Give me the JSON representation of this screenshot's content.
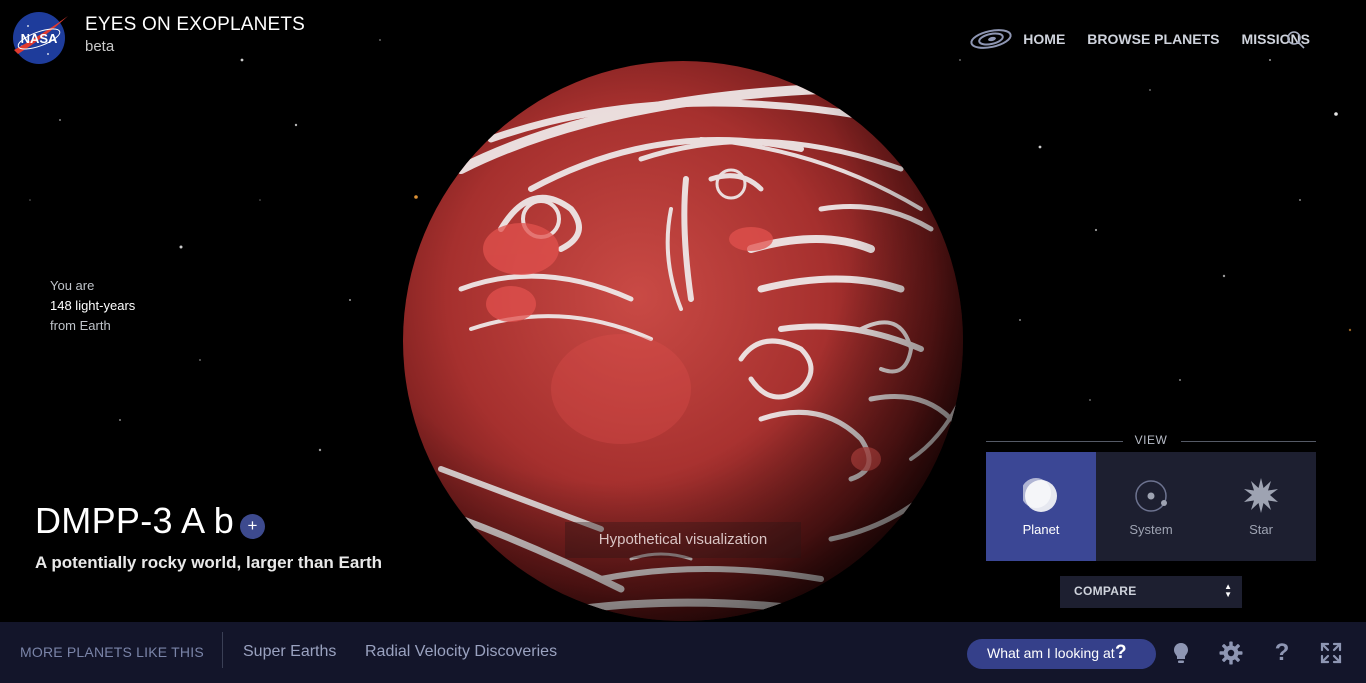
{
  "header": {
    "title": "EYES ON EXOPLANETS",
    "subtitle": "beta",
    "logo_text": "NASA",
    "nav": [
      {
        "label": "HOME"
      },
      {
        "label": "BROWSE PLANETS"
      },
      {
        "label": "MISSIONS"
      }
    ]
  },
  "distance": {
    "line1": "You are",
    "line2": "148 light-years",
    "line3": "from Earth"
  },
  "planet": {
    "name": "DMPP-3 A b",
    "plus_label": "+",
    "description": "A potentially rocky world, larger than Earth",
    "visualization_note": "Hypothetical visualization"
  },
  "view": {
    "heading": "VIEW",
    "options": [
      {
        "label": "Planet",
        "icon": "planet-icon",
        "active": true
      },
      {
        "label": "System",
        "icon": "system-icon",
        "active": false
      },
      {
        "label": "Star",
        "icon": "star-icon",
        "active": false
      }
    ],
    "compare_label": "COMPARE"
  },
  "bottom_bar": {
    "more_label": "MORE PLANETS LIKE THIS",
    "links": [
      {
        "label": "Super Earths"
      },
      {
        "label": "Radial Velocity Discoveries"
      }
    ],
    "look_label": "What am I looking at",
    "look_icon_label": "?",
    "help_label": "?"
  },
  "colors": {
    "accent": "#3b4795",
    "panel": "#1d1f30",
    "bar": "#13152a",
    "planet": "#b83a38"
  }
}
